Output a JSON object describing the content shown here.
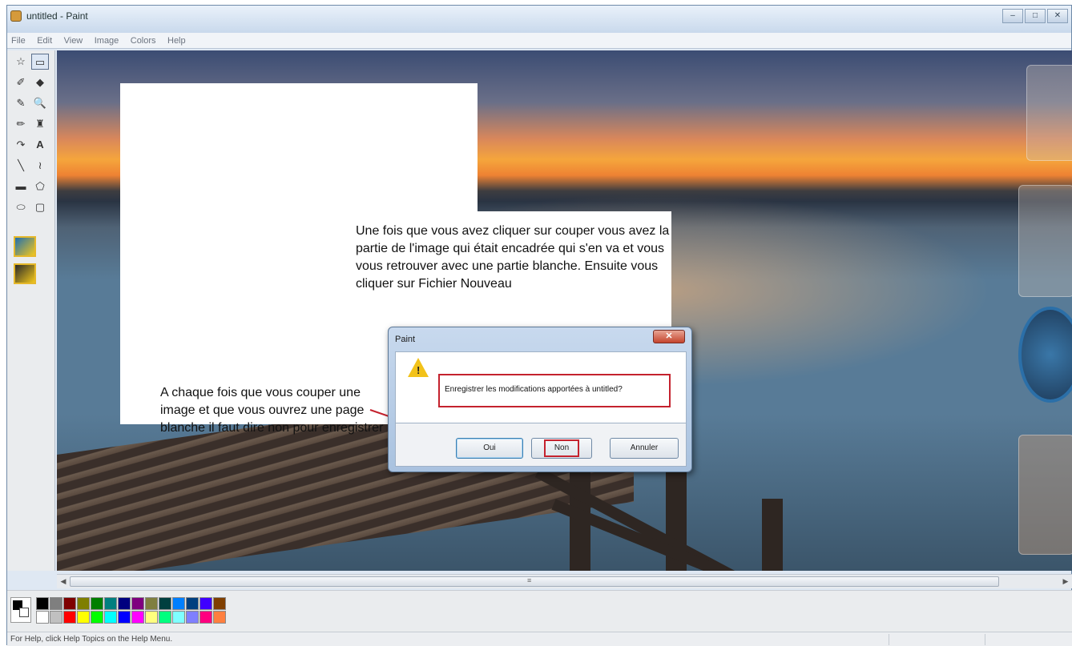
{
  "window": {
    "title": "untitled - Paint",
    "controls": [
      "–",
      "□",
      "✕"
    ]
  },
  "menu": [
    "File",
    "Edit",
    "View",
    "Image",
    "Colors",
    "Help"
  ],
  "toolbox": {
    "tools": [
      {
        "name": "free-select-icon",
        "glyph": "☆"
      },
      {
        "name": "select-icon",
        "glyph": "▭"
      },
      {
        "name": "eraser-icon",
        "glyph": "✐"
      },
      {
        "name": "fill-icon",
        "glyph": "◆"
      },
      {
        "name": "color-picker-icon",
        "glyph": "✎"
      },
      {
        "name": "magnifier-icon",
        "glyph": "🔍"
      },
      {
        "name": "pencil-icon",
        "glyph": "✏"
      },
      {
        "name": "brush-icon",
        "glyph": "♜"
      },
      {
        "name": "airbrush-icon",
        "glyph": "↷"
      },
      {
        "name": "text-icon",
        "glyph": "A"
      },
      {
        "name": "line-icon",
        "glyph": "╲"
      },
      {
        "name": "curve-icon",
        "glyph": "≀"
      },
      {
        "name": "rectangle-icon",
        "glyph": "▬"
      },
      {
        "name": "polygon-icon",
        "glyph": "⬠"
      },
      {
        "name": "ellipse-icon",
        "glyph": "⬭"
      },
      {
        "name": "rounded-rect-icon",
        "glyph": "▢"
      }
    ]
  },
  "palette_colors": [
    "#000000",
    "#7f7f7f",
    "#7f0000",
    "#7f7f00",
    "#007f00",
    "#007f7f",
    "#00007f",
    "#7f007f",
    "#7f7f3f",
    "#003f3f",
    "#007fff",
    "#003f7f",
    "#3f00ff",
    "#7f3f00",
    "#ffffff",
    "#c0c0c0",
    "#ff0000",
    "#ffff00",
    "#00ff00",
    "#00ffff",
    "#0000ff",
    "#ff00ff",
    "#ffff7f",
    "#00ff7f",
    "#7fffff",
    "#7f7fff",
    "#ff007f",
    "#ff7f3f"
  ],
  "status": {
    "text": "For Help, click Help Topics on the Help Menu."
  },
  "annotations": {
    "note_1": "Une fois que vous avez cliquer sur couper vous avez la partie de l'image qui était encadrée qui s'en va et vous vous retrouver avec une partie blanche. Ensuite vous cliquer sur Fichier Nouveau",
    "note_2": "A chaque fois que vous couper une image et que vous ouvrez une page blanche il faut dire non pour enregistrer"
  },
  "dialog": {
    "title": "Paint",
    "close": "✕",
    "message": "Enregistrer les modifications apportées à untitled?",
    "buttons": {
      "yes": "Oui",
      "no": "Non",
      "cancel": "Annuler"
    }
  },
  "scroll": {
    "thumb_glyph": "≡",
    "left": "◀",
    "right": "▶"
  }
}
